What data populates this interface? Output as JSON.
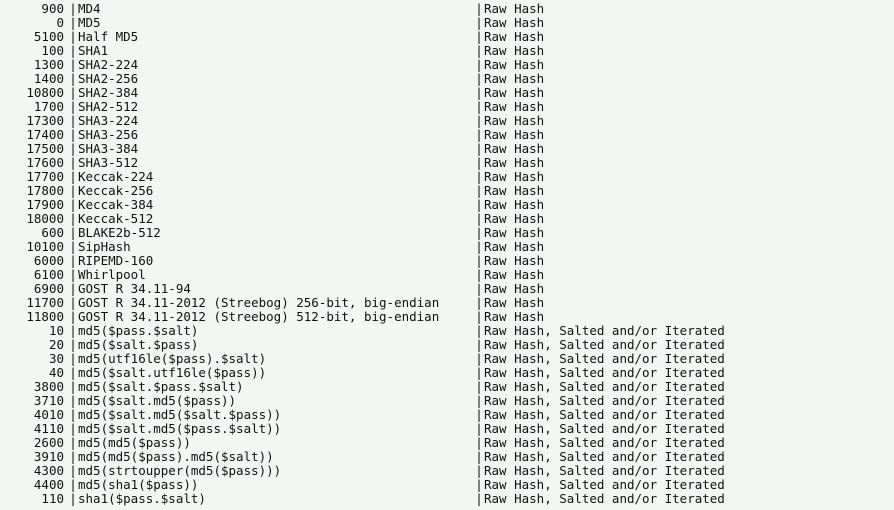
{
  "divider": "|",
  "rows": [
    {
      "id": "900",
      "name": "MD4",
      "category": "Raw Hash"
    },
    {
      "id": "0",
      "name": "MD5",
      "category": "Raw Hash"
    },
    {
      "id": "5100",
      "name": "Half MD5",
      "category": "Raw Hash"
    },
    {
      "id": "100",
      "name": "SHA1",
      "category": "Raw Hash"
    },
    {
      "id": "1300",
      "name": "SHA2-224",
      "category": "Raw Hash"
    },
    {
      "id": "1400",
      "name": "SHA2-256",
      "category": "Raw Hash"
    },
    {
      "id": "10800",
      "name": "SHA2-384",
      "category": "Raw Hash"
    },
    {
      "id": "1700",
      "name": "SHA2-512",
      "category": "Raw Hash"
    },
    {
      "id": "17300",
      "name": "SHA3-224",
      "category": "Raw Hash"
    },
    {
      "id": "17400",
      "name": "SHA3-256",
      "category": "Raw Hash"
    },
    {
      "id": "17500",
      "name": "SHA3-384",
      "category": "Raw Hash"
    },
    {
      "id": "17600",
      "name": "SHA3-512",
      "category": "Raw Hash"
    },
    {
      "id": "17700",
      "name": "Keccak-224",
      "category": "Raw Hash"
    },
    {
      "id": "17800",
      "name": "Keccak-256",
      "category": "Raw Hash"
    },
    {
      "id": "17900",
      "name": "Keccak-384",
      "category": "Raw Hash"
    },
    {
      "id": "18000",
      "name": "Keccak-512",
      "category": "Raw Hash"
    },
    {
      "id": "600",
      "name": "BLAKE2b-512",
      "category": "Raw Hash"
    },
    {
      "id": "10100",
      "name": "SipHash",
      "category": "Raw Hash"
    },
    {
      "id": "6000",
      "name": "RIPEMD-160",
      "category": "Raw Hash"
    },
    {
      "id": "6100",
      "name": "Whirlpool",
      "category": "Raw Hash"
    },
    {
      "id": "6900",
      "name": "GOST R 34.11-94",
      "category": "Raw Hash"
    },
    {
      "id": "11700",
      "name": "GOST R 34.11-2012 (Streebog) 256-bit, big-endian",
      "category": "Raw Hash"
    },
    {
      "id": "11800",
      "name": "GOST R 34.11-2012 (Streebog) 512-bit, big-endian",
      "category": "Raw Hash"
    },
    {
      "id": "10",
      "name": "md5($pass.$salt)",
      "category": "Raw Hash, Salted and/or Iterated"
    },
    {
      "id": "20",
      "name": "md5($salt.$pass)",
      "category": "Raw Hash, Salted and/or Iterated"
    },
    {
      "id": "30",
      "name": "md5(utf16le($pass).$salt)",
      "category": "Raw Hash, Salted and/or Iterated"
    },
    {
      "id": "40",
      "name": "md5($salt.utf16le($pass))",
      "category": "Raw Hash, Salted and/or Iterated"
    },
    {
      "id": "3800",
      "name": "md5($salt.$pass.$salt)",
      "category": "Raw Hash, Salted and/or Iterated"
    },
    {
      "id": "3710",
      "name": "md5($salt.md5($pass))",
      "category": "Raw Hash, Salted and/or Iterated"
    },
    {
      "id": "4010",
      "name": "md5($salt.md5($salt.$pass))",
      "category": "Raw Hash, Salted and/or Iterated"
    },
    {
      "id": "4110",
      "name": "md5($salt.md5($pass.$salt))",
      "category": "Raw Hash, Salted and/or Iterated"
    },
    {
      "id": "2600",
      "name": "md5(md5($pass))",
      "category": "Raw Hash, Salted and/or Iterated"
    },
    {
      "id": "3910",
      "name": "md5(md5($pass).md5($salt))",
      "category": "Raw Hash, Salted and/or Iterated"
    },
    {
      "id": "4300",
      "name": "md5(strtoupper(md5($pass)))",
      "category": "Raw Hash, Salted and/or Iterated"
    },
    {
      "id": "4400",
      "name": "md5(sha1($pass))",
      "category": "Raw Hash, Salted and/or Iterated"
    },
    {
      "id": "110",
      "name": "sha1($pass.$salt)",
      "category": "Raw Hash, Salted and/or Iterated"
    }
  ]
}
